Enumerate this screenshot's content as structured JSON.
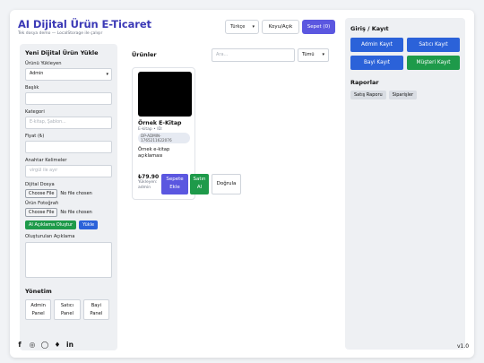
{
  "header": {
    "title": "AI Dijital Ürün E-Ticaret",
    "subtitle": "Tek dosya demo — LocalStorage ile çalışır",
    "language": "Türkçe",
    "theme_label": "Koyu/Açık",
    "cart_label": "Sepet (0)"
  },
  "upload_panel": {
    "title": "Yeni Dijital Ürün Yükle",
    "uploader_label": "Ürünü Yükleyen",
    "uploader_value": "Admin",
    "title_label": "Başlık",
    "title_value": "",
    "category_label": "Kategori",
    "category_placeholder": "E-kitap, Şablon...",
    "price_label": "Fiyat (₺)",
    "price_value": "",
    "keywords_label": "Anahtar Kelimeler",
    "keywords_placeholder": "virgül ile ayır",
    "digital_file_label": "Dijital Dosya",
    "photo_label": "Ürün Fotoğrafı",
    "choose_file": "Choose File",
    "no_file": "No file chosen",
    "ai_button": "AI Açıklama Oluştur",
    "upload_button": "Yükle",
    "generated_desc_label": "Oluşturulan Açıklama"
  },
  "admin": {
    "title": "Yönetim",
    "panels": [
      {
        "line1": "Admin",
        "line2": "Panel"
      },
      {
        "line1": "Satıcı",
        "line2": "Panel"
      },
      {
        "line1": "Bayi",
        "line2": "Panel"
      }
    ]
  },
  "products": {
    "heading": "Ürünler",
    "search_placeholder": "Ara...",
    "filter_value": "Tümü",
    "items": [
      {
        "name": "Örnek E-Kitap",
        "meta": "E-kitap • ID:",
        "id": "DP-ADMIN-1765211622076",
        "description": "Örnek e-kitap açıklaması",
        "price": "₺79.90",
        "seller_line1": "Yükleyen:",
        "seller_line2": "admin",
        "add_to_cart_l1": "Sepete",
        "add_to_cart_l2": "Ekle",
        "buy_l1": "Satın",
        "buy_l2": "Al",
        "verify": "Doğrula"
      }
    ]
  },
  "right_panel": {
    "auth_title": "Giriş / Kayıt",
    "buttons": [
      "Admin Kayıt",
      "Satıcı Kayıt",
      "Bayi Kayıt",
      "Müşteri Kayıt"
    ],
    "reports_title": "Raporlar",
    "report_buttons": [
      "Satış Raporu",
      "Siparişler"
    ]
  },
  "footer": {
    "social_icons": [
      "facebook-icon",
      "instagram-icon",
      "whatsapp-icon",
      "twitter-icon",
      "linkedin-icon"
    ],
    "version": "v1.0"
  },
  "colors": {
    "brand": "#3b39b6",
    "primary": "#5b57e0",
    "blue": "#2b62d9",
    "green": "#1e9a4a"
  }
}
